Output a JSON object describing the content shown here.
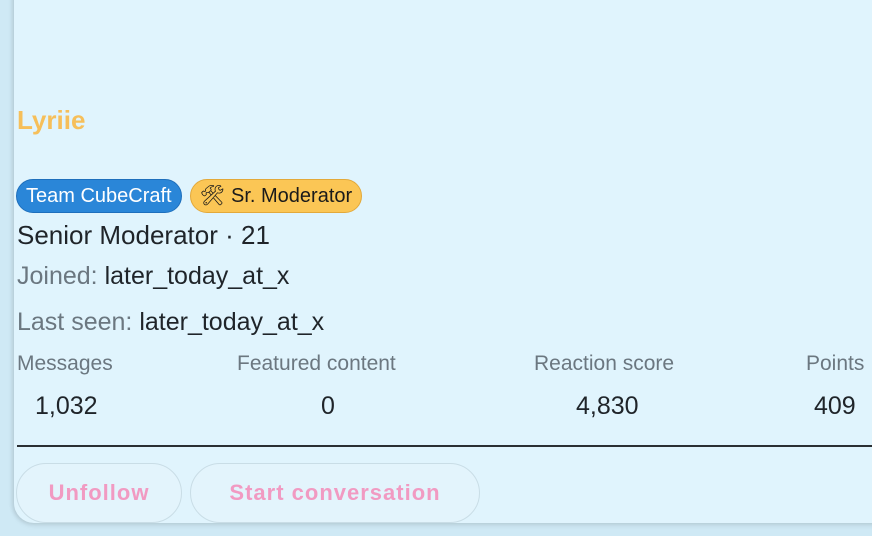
{
  "profile": {
    "username": "Lyriie",
    "badges": {
      "team": "Team CubeCraft",
      "moderator_icon": "🛠",
      "moderator": "Sr. Moderator"
    },
    "title_line": "Senior Moderator · 21",
    "joined_label": "Joined:",
    "joined_value": "later_today_at_x",
    "last_seen_label": "Last seen:",
    "last_seen_value": "later_today_at_x"
  },
  "stats": {
    "messages_label": "Messages",
    "messages_value": "1,032",
    "featured_label": "Featured content",
    "featured_value": "0",
    "reaction_label": "Reaction score",
    "reaction_value": "4,830",
    "points_label": "Points",
    "points_value": "409"
  },
  "actions": {
    "unfollow": "Unfollow",
    "start_conversation": "Start conversation"
  },
  "colors": {
    "username": "#f6bf5a",
    "team_badge": "#2a86d8",
    "moderator_badge": "#fbc655",
    "button_text": "#f19ac2",
    "card_background": "#e0f4fd"
  }
}
